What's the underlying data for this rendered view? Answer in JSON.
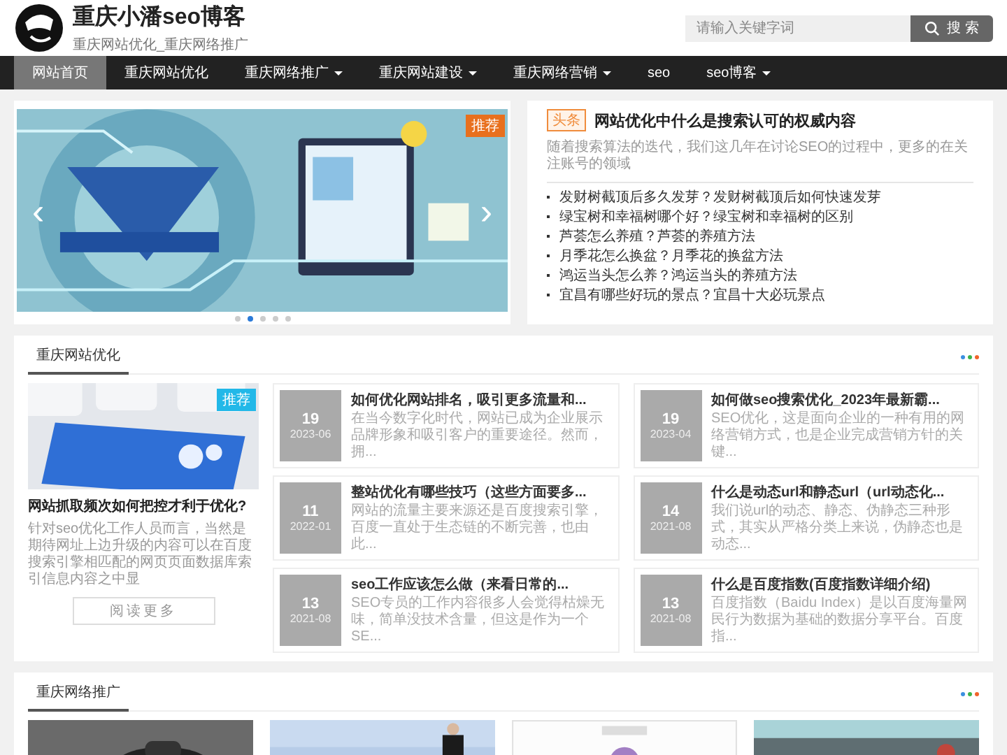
{
  "site": {
    "title": "重庆小潘seo博客",
    "subtitle": "重庆网站优化_重庆网络推广"
  },
  "search": {
    "placeholder": "请输入关键字词",
    "button": "搜 索"
  },
  "nav": [
    {
      "label": "网站首页",
      "selected": true,
      "dropdown": false
    },
    {
      "label": "重庆网站优化",
      "selected": false,
      "dropdown": false
    },
    {
      "label": "重庆网络推广",
      "selected": false,
      "dropdown": true
    },
    {
      "label": "重庆网站建设",
      "selected": false,
      "dropdown": true
    },
    {
      "label": "重庆网络营销",
      "selected": false,
      "dropdown": true
    },
    {
      "label": "seo",
      "selected": false,
      "dropdown": false
    },
    {
      "label": "seo博客",
      "selected": false,
      "dropdown": true
    }
  ],
  "slider": {
    "badge": "推荐",
    "prev": "‹",
    "next": "›",
    "dots": [
      {
        "selected": false
      },
      {
        "selected": true
      },
      {
        "selected": false
      },
      {
        "selected": false
      },
      {
        "selected": false
      }
    ]
  },
  "headline": {
    "tag": "头条",
    "title": "网站优化中什么是搜索认可的权威内容",
    "summary": "随着搜索算法的迭代，我们这几年在讨论SEO的过程中，更多的在关注账号的领域"
  },
  "hot_list": [
    "发财树截顶后多久发芽？发财树截顶后如何快速发芽",
    "绿宝树和幸福树哪个好？绿宝树和幸福树的区别",
    "芦荟怎么养殖？芦荟的养殖方法",
    "月季花怎么换盆？月季花的换盆方法",
    "鸿运当头怎么养？鸿运当头的养殖方法",
    "宜昌有哪些好玩的景点？宜昌十大必玩景点"
  ],
  "sections": [
    {
      "title": "重庆网站优化",
      "dots": [
        {
          "color": "#3b8fe0"
        },
        {
          "color": "#3cb44b"
        },
        {
          "color": "#f0642a"
        }
      ],
      "featured": {
        "badge": "推荐",
        "title": "网站抓取频次如何把控才利于优化?",
        "summary": "针对seo优化工作人员而言，当然是期待网址上边升级的内容可以在百度搜索引擎相匹配的网页页面数据库索引信息内容之中显",
        "more": "阅读更多"
      },
      "posts": [
        {
          "day": "19",
          "month": "2023-06",
          "title": "如何优化网站排名，吸引更多流量和...",
          "summary": "在当今数字化时代，网站已成为企业展示品牌形象和吸引客户的重要途径。然而，拥..."
        },
        {
          "day": "19",
          "month": "2023-04",
          "title": "如何做seo搜索优化_2023年最新霸...",
          "summary": "SEO优化，这是面向企业的一种有用的网络营销方式，也是企业完成营销方针的关键..."
        },
        {
          "day": "11",
          "month": "2022-01",
          "title": "整站优化有哪些技巧（这些方面要多...",
          "summary": "网站的流量主要来源还是百度搜索引擎，百度一直处于生态链的不断完善，也由此..."
        },
        {
          "day": "14",
          "month": "2021-08",
          "title": "什么是动态url和静态url（url动态化...",
          "summary": "我们说url的动态、静态、伪静态三种形式，其实从严格分类上来说，伪静态也是动态..."
        },
        {
          "day": "13",
          "month": "2021-08",
          "title": "seo工作应该怎么做（来看日常的...",
          "summary": "SEO专员的工作内容很多人会觉得枯燥无味，简单没技术含量，但这是作为一个SE..."
        },
        {
          "day": "13",
          "month": "2021-08",
          "title": "什么是百度指数(百度指数详细介绍)",
          "summary": "百度指数（Baidu Index）是以百度海量网民行为数据为基础的数据分享平台。百度指..."
        }
      ]
    },
    {
      "title": "重庆网络推广",
      "dots": [
        {
          "color": "#3b8fe0"
        },
        {
          "color": "#3cb44b"
        },
        {
          "color": "#f0642a"
        }
      ]
    }
  ]
}
